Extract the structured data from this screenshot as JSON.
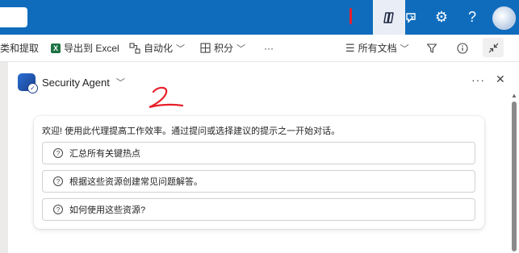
{
  "topbar": {
    "copilot_icon": "copilot-icon",
    "feedback_icon": "feedback-icon",
    "settings_icon": "gear-icon",
    "help_label": "?",
    "brand_color": "#0f6cbd"
  },
  "toolbar": {
    "classify_label": "类和提取",
    "export_label": "导出到 Excel",
    "automate_label": "自动化",
    "points_label": "积分",
    "more_label": "···",
    "all_docs_label": "所有文档",
    "excel_glyph": "X"
  },
  "agent": {
    "title": "Security Agent",
    "welcome": "欢迎! 使用此代理提高工作效率。通过提问或选择建议的提示之一开始对话。",
    "prompts": [
      "汇总所有关键热点",
      "根据这些资源创建常见问题解答。",
      "如何使用这些资源?"
    ],
    "more_label": "···",
    "close_label": "✕"
  }
}
